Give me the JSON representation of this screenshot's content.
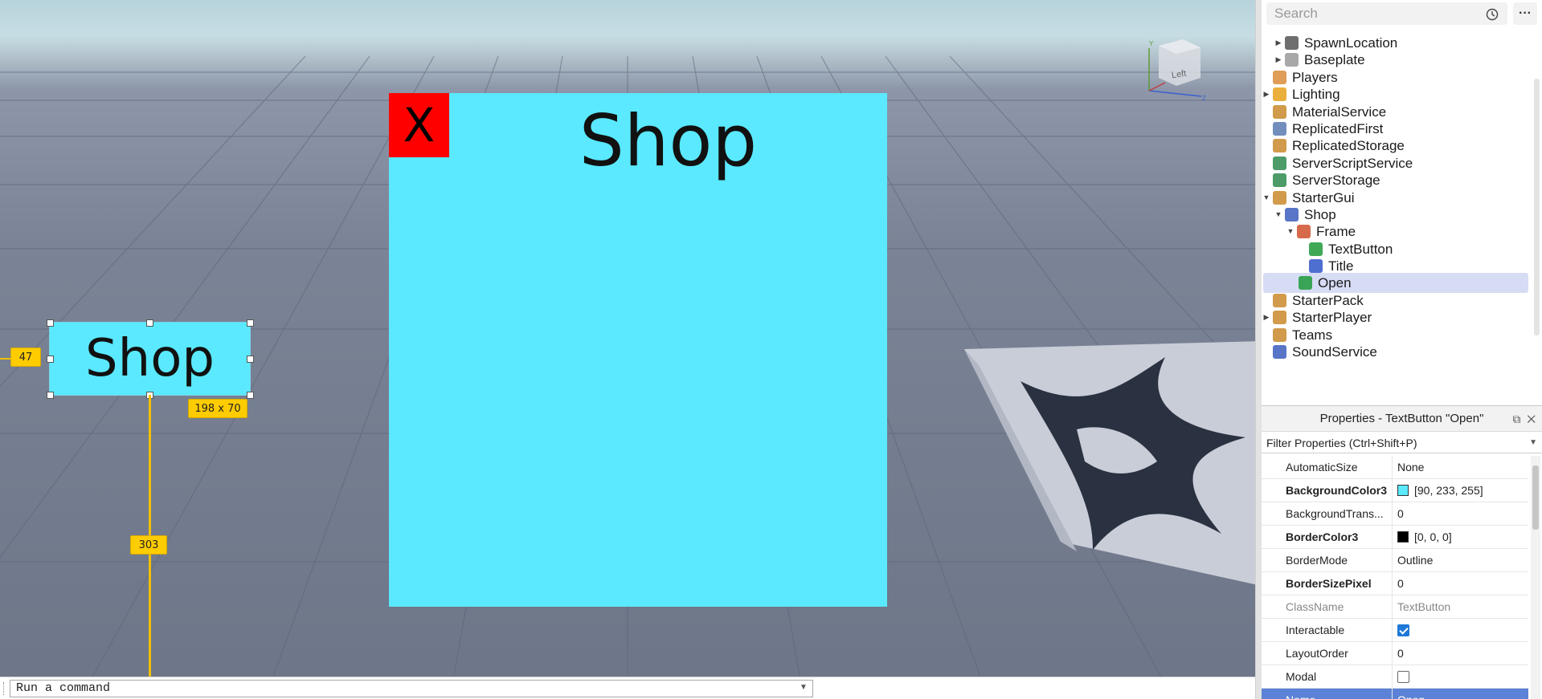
{
  "viewport": {
    "frame_title": "Shop",
    "close_label": "X",
    "open_button_label": "Shop",
    "size_badge": "198 x 70",
    "left_offset_badge": "47",
    "bottom_offset_badge": "303",
    "view_cube_label": "Left",
    "frame_color": "#5ae9ff",
    "close_color": "#ff0000"
  },
  "command_bar": {
    "placeholder": "Run a command"
  },
  "explorer": {
    "search_placeholder": "Search",
    "more_label": "···",
    "items": [
      {
        "label": "SpawnLocation",
        "icon": "gear-icon",
        "arrow": "▶"
      },
      {
        "label": "Baseplate",
        "icon": "part-icon",
        "arrow": "▶"
      },
      {
        "label": "Players",
        "icon": "players-icon",
        "arrow": ""
      },
      {
        "label": "Lighting",
        "icon": "lightbulb-icon",
        "arrow": "▶"
      },
      {
        "label": "MaterialService",
        "icon": "material-icon",
        "arrow": ""
      },
      {
        "label": "ReplicatedFirst",
        "icon": "replicated-first-icon",
        "arrow": ""
      },
      {
        "label": "ReplicatedStorage",
        "icon": "replicated-storage-icon",
        "arrow": ""
      },
      {
        "label": "ServerScriptService",
        "icon": "server-script-icon",
        "arrow": ""
      },
      {
        "label": "ServerStorage",
        "icon": "server-storage-icon",
        "arrow": ""
      },
      {
        "label": "StarterGui",
        "icon": "starter-gui-icon",
        "arrow": "▼"
      },
      {
        "label": "Shop",
        "icon": "screen-gui-icon",
        "arrow": "▼"
      },
      {
        "label": "Frame",
        "icon": "frame-icon",
        "arrow": "▼"
      },
      {
        "label": "TextButton",
        "icon": "text-button-icon",
        "arrow": ""
      },
      {
        "label": "Title",
        "icon": "text-label-icon",
        "arrow": ""
      },
      {
        "label": "Open",
        "icon": "text-button-icon",
        "arrow": ""
      },
      {
        "label": "StarterPack",
        "icon": "starter-pack-icon",
        "arrow": ""
      },
      {
        "label": "StarterPlayer",
        "icon": "starter-player-icon",
        "arrow": "▶"
      },
      {
        "label": "Teams",
        "icon": "teams-icon",
        "arrow": ""
      },
      {
        "label": "SoundService",
        "icon": "sound-icon",
        "arrow": ""
      }
    ]
  },
  "properties": {
    "title": "Properties - TextButton \"Open\"",
    "filter_placeholder": "Filter Properties (Ctrl+Shift+P)",
    "rows": [
      {
        "key": "AutomaticSize",
        "value": "None"
      },
      {
        "key": "BackgroundColor3",
        "value": "[90, 233, 255]",
        "swatch": "#5ae9ff"
      },
      {
        "key": "BackgroundTrans...",
        "value": "0"
      },
      {
        "key": "BorderColor3",
        "value": "[0, 0, 0]",
        "swatch": "#000000"
      },
      {
        "key": "BorderMode",
        "value": "Outline"
      },
      {
        "key": "BorderSizePixel",
        "value": "0"
      },
      {
        "key": "ClassName",
        "value": "TextButton"
      },
      {
        "key": "Interactable",
        "value": "",
        "checked": true
      },
      {
        "key": "LayoutOrder",
        "value": "0"
      },
      {
        "key": "Modal",
        "value": "",
        "checked": false
      },
      {
        "key": "Name",
        "value": "Open"
      }
    ]
  }
}
